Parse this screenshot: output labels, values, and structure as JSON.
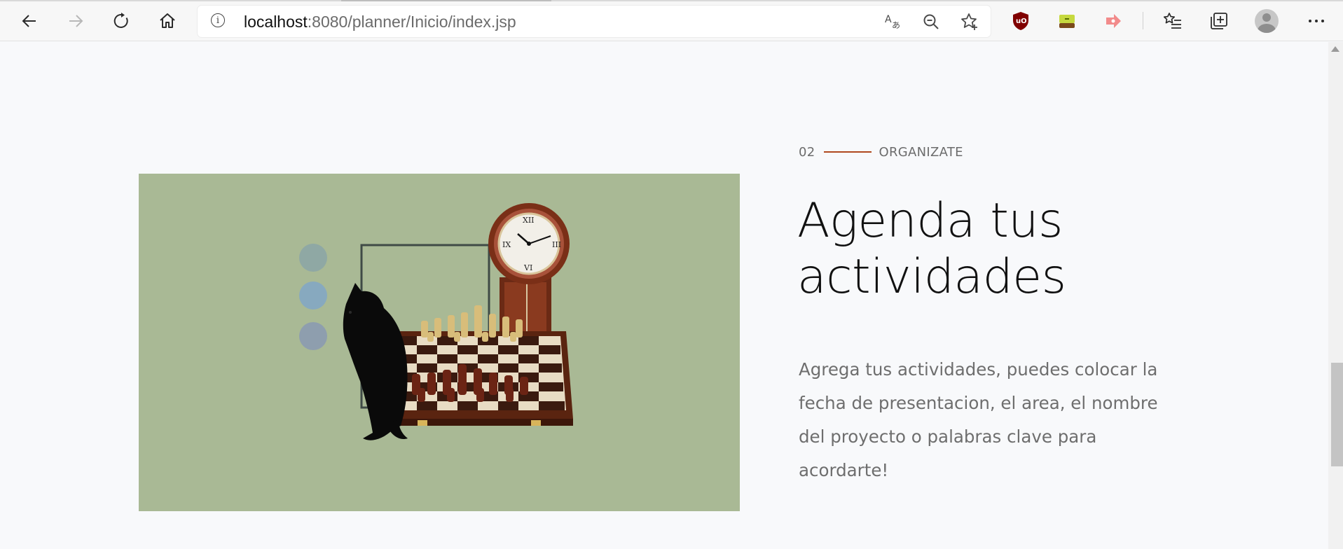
{
  "browser": {
    "url_host": "localhost",
    "url_rest": ":8080/planner/Inicio/index.jsp",
    "icons": {
      "back": "arrow-left-icon",
      "forward": "arrow-right-icon",
      "refresh": "refresh-icon",
      "home": "home-icon",
      "site_info": "info-icon",
      "translate": "translate-icon",
      "zoom": "zoom-out-icon",
      "favorite": "star-add-icon",
      "ublock": "ublock-origin-icon",
      "extension_2": "pot-extension-icon",
      "extension_3": "arrow-extension-icon",
      "favorites": "favorites-list-icon",
      "collections": "collections-icon",
      "profile": "profile-avatar-icon",
      "menu": "more-icon"
    }
  },
  "section": {
    "number": "02",
    "label": "ORGANIZATE",
    "title_line1": "Agenda tus",
    "title_line2": "actividades",
    "body": "Agrega tus actividades, puedes colocar la fecha de presentacion, el area, el nombre del proyecto o palabras clave para acordarte!",
    "accent_color": "#b0481e",
    "image_bg_color": "#a9b995"
  }
}
